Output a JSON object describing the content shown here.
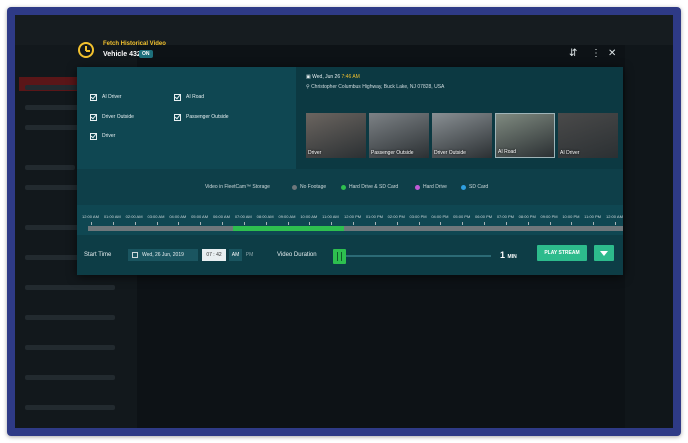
{
  "header": {
    "title": "Fetch Historical Video",
    "vehicle": "Vehicle 432",
    "status": "ON",
    "icons": [
      "sort-icon",
      "more-vertical-icon",
      "close-icon"
    ]
  },
  "cameras": [
    {
      "label": "AI Driver",
      "checked": true
    },
    {
      "label": "AI Road",
      "checked": true
    },
    {
      "label": "Driver Outside",
      "checked": true
    },
    {
      "label": "Passenger Outside",
      "checked": true
    },
    {
      "label": "Driver",
      "checked": true
    }
  ],
  "info": {
    "date": "Wed, Jun 26",
    "time": "7:46 AM",
    "location": "Christopher Columbus Highway, Buck Lake, NJ 07828, USA"
  },
  "thumbnails": [
    {
      "label": "Driver",
      "color": "#6b6560"
    },
    {
      "label": "Passenger Outside",
      "color": "#7d8286"
    },
    {
      "label": "Driver Outside",
      "color": "#8a9094"
    },
    {
      "label": "AI Road",
      "color": "#7f8a80"
    },
    {
      "label": "AI Driver",
      "color": "#4a4a4a"
    }
  ],
  "legend": {
    "title": "Video in FleetCam™ Storage",
    "items": [
      {
        "label": "No Footage",
        "color": "#6e777b"
      },
      {
        "label": "Hard Drive & SD Card",
        "color": "#2ebf4f"
      },
      {
        "label": "Hard Drive",
        "color": "#c05ad6"
      },
      {
        "label": "SD Card",
        "color": "#2f9fe0"
      }
    ]
  },
  "timeline": {
    "ticks": [
      "12:00 AM",
      "01:00 AM",
      "02:00 AM",
      "03:00 AM",
      "04:00 AM",
      "05:00 AM",
      "06:00 AM",
      "07:00 AM",
      "08:00 AM",
      "09:00 AM",
      "10:00 AM",
      "11:00 AM",
      "12:00 PM",
      "01:00 PM",
      "02:00 PM",
      "03:00 PM",
      "04:00 PM",
      "05:00 PM",
      "06:00 PM",
      "07:00 PM",
      "08:00 PM",
      "09:00 PM",
      "10:00 PM",
      "11:00 PM",
      "12:00 AM"
    ],
    "footage_start_hour": 6.5,
    "footage_end_hour": 11.6
  },
  "controls": {
    "start_time_label": "Start Time",
    "date_value": "Wed, 26 Jun, 2019",
    "time_value": "07 : 42",
    "am_label": "AM",
    "pm_label": "PM",
    "duration_label": "Video Duration",
    "duration_value": "1",
    "duration_unit": "MIN",
    "duration_fraction": 0.0,
    "play_label": "PLAY STREAM"
  },
  "colors": {
    "accent": "#f2c12e",
    "modal": "#0f4752",
    "button": "#2dbb8c"
  }
}
